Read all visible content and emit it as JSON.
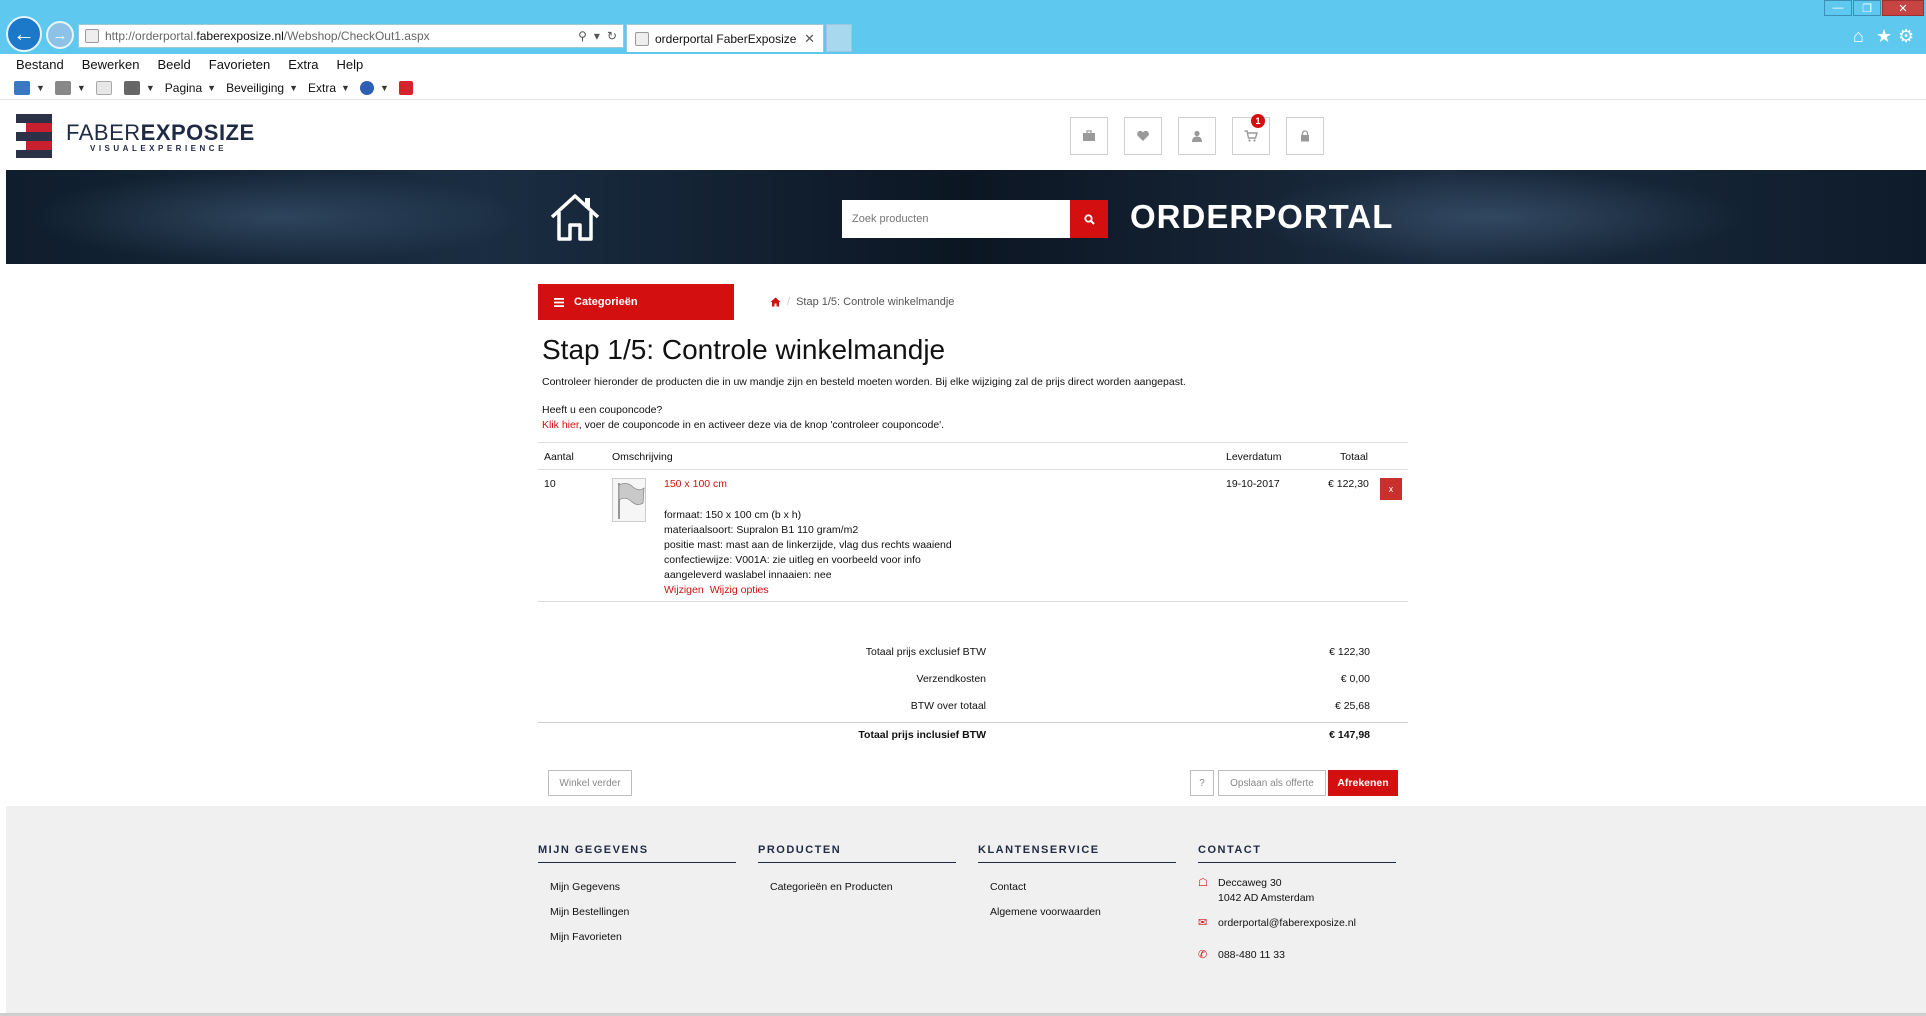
{
  "browser": {
    "url_prefix": "http://orderportal.",
    "url_domain": "faberexposize.nl",
    "url_path": "/Webshop/CheckOut1.aspx",
    "tab_title": "orderportal FaberExposize",
    "menu": [
      "Bestand",
      "Bewerken",
      "Beeld",
      "Favorieten",
      "Extra",
      "Help"
    ],
    "commands": {
      "pagina": "Pagina",
      "beveiliging": "Beveiliging",
      "extra": "Extra"
    }
  },
  "site": {
    "logo_faber": "FABER",
    "logo_exposize": "EXPOSIZE",
    "logo_tagline": "VISUALEXPERIENCE",
    "cart_count": "1",
    "search_placeholder": "Zoek producten",
    "portal_title": "ORDERPORTAL",
    "categories_label": "Categorieën",
    "breadcrumb_current": "Stap 1/5: Controle winkelmandje",
    "accent_color": "#d40f0f"
  },
  "checkout": {
    "title": "Stap 1/5: Controle winkelmandje",
    "intro": "Controleer hieronder de producten die in uw mandje zijn en besteld moeten worden. Bij elke wijziging zal de prijs direct worden aangepast.",
    "coupon_question": "Heeft u een couponcode?",
    "coupon_link": "Klik hier",
    "coupon_rest": ", voer de couponcode in en activeer deze via de knop 'controleer couponcode'.",
    "columns": {
      "qty": "Aantal",
      "desc": "Omschrijving",
      "date": "Leverdatum",
      "total": "Totaal"
    },
    "item": {
      "qty": "10",
      "name": "150 x 100 cm",
      "specs": [
        "formaat: 150 x 100 cm (b x h)",
        "materiaalsoort: Supralon B1 110 gram/m2",
        "positie mast: mast aan de linkerzijde, vlag dus rechts waaiend",
        "confectiewijze: V001A: zie uitleg en voorbeeld voor info",
        "aangeleverd waslabel innaaien: nee"
      ],
      "edit": "Wijzigen",
      "edit_options": "Wijzig opties",
      "date": "19-10-2017",
      "total": "€ 122,30",
      "remove": "x"
    },
    "totals": [
      {
        "label": "Totaal prijs exclusief BTW",
        "value": "€ 122,30"
      },
      {
        "label": "Verzendkosten",
        "value": "€ 0,00"
      },
      {
        "label": "BTW over totaal",
        "value": "€ 25,68"
      }
    ],
    "grand_total": {
      "label": "Totaal prijs inclusief BTW",
      "value": "€ 147,98"
    },
    "buttons": {
      "continue": "Winkel verder",
      "help": "?",
      "save_quote": "Opslaan als offerte",
      "checkout": "Afrekenen"
    }
  },
  "footer": {
    "col1": {
      "title": "MIJN GEGEVENS",
      "links": [
        "Mijn Gegevens",
        "Mijn Bestellingen",
        "Mijn Favorieten"
      ]
    },
    "col2": {
      "title": "PRODUCTEN",
      "links": [
        "Categorieën en Producten"
      ]
    },
    "col3": {
      "title": "KLANTENSERVICE",
      "links": [
        "Contact",
        "Algemene voorwaarden"
      ]
    },
    "col4": {
      "title": "CONTACT",
      "address_line1": "Deccaweg 30",
      "address_line2": "1042 AD Amsterdam",
      "email": "orderportal@faberexposize.nl",
      "phone": "088-480 11 33"
    }
  }
}
